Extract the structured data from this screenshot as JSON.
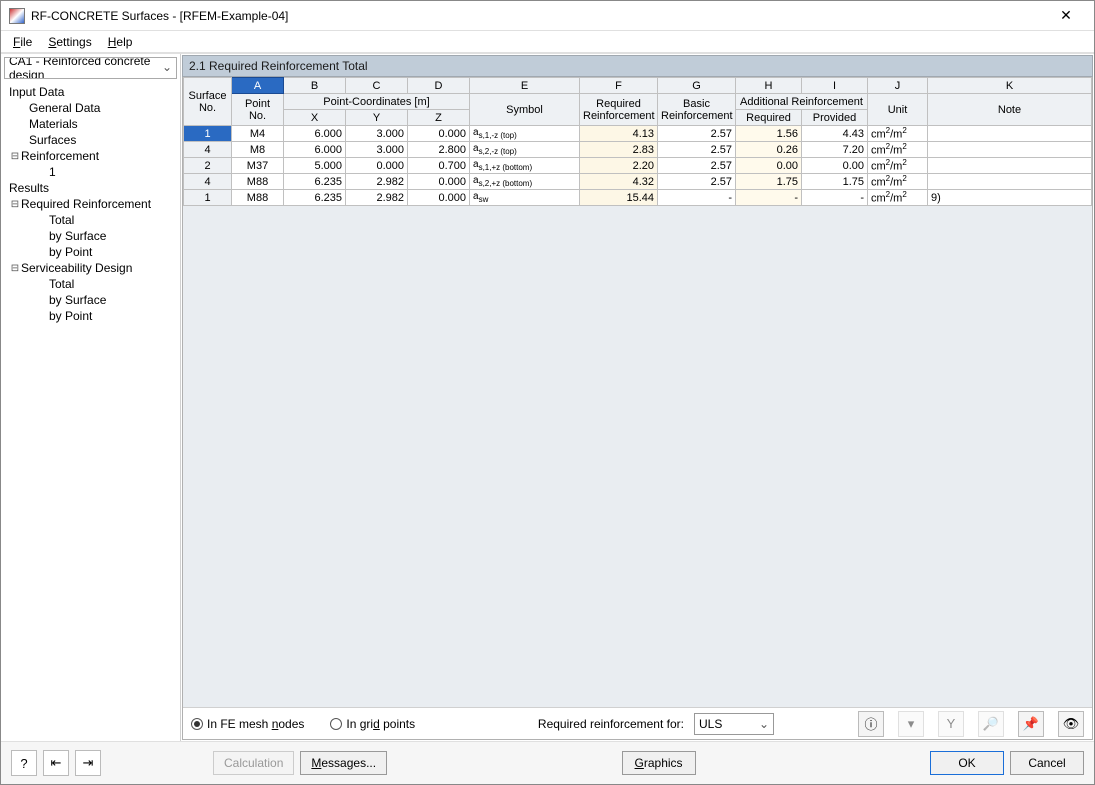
{
  "window": {
    "title": "RF-CONCRETE Surfaces - [RFEM-Example-04]"
  },
  "menu": {
    "file": "File",
    "settings": "Settings",
    "help": "Help"
  },
  "sidebar": {
    "combo": "CA1 - Reinforced concrete design",
    "tree": {
      "input_data": "Input Data",
      "general_data": "General Data",
      "materials": "Materials",
      "surfaces": "Surfaces",
      "reinforcement": "Reinforcement",
      "one": "1",
      "results": "Results",
      "required_reinforcement": "Required Reinforcement",
      "total": "Total",
      "by_surface": "by Surface",
      "by_point": "by Point",
      "serviceability": "Serviceability Design",
      "total2": "Total",
      "by_surface2": "by Surface",
      "by_point2": "by Point"
    }
  },
  "panel": {
    "title": "2.1 Required Reinforcement Total"
  },
  "columns": {
    "letters": [
      "A",
      "B",
      "C",
      "D",
      "E",
      "F",
      "G",
      "H",
      "I",
      "J",
      "K"
    ],
    "h_surface": "Surface\nNo.",
    "h_point": "Point\nNo.",
    "h_coords": "Point-Coordinates [m]",
    "h_x": "X",
    "h_y": "Y",
    "h_z": "Z",
    "h_symbol": "Symbol",
    "h_req": "Required\nReinforcement",
    "h_basic": "Basic\nReinforcement",
    "h_add": "Additional Reinforcement",
    "h_add_req": "Required",
    "h_add_prov": "Provided",
    "h_unit": "Unit",
    "h_note": "Note"
  },
  "rows": [
    {
      "surf": "1",
      "pt": "M4",
      "x": "6.000",
      "y": "3.000",
      "z": "0.000",
      "sym": "a s,1,-z (top)",
      "req": "4.13",
      "basic": "2.57",
      "areq": "1.56",
      "aprov": "4.43",
      "unit": "cm²/m",
      "note": ""
    },
    {
      "surf": "4",
      "pt": "M8",
      "x": "6.000",
      "y": "3.000",
      "z": "2.800",
      "sym": "a s,2,-z (top)",
      "req": "2.83",
      "basic": "2.57",
      "areq": "0.26",
      "aprov": "7.20",
      "unit": "cm²/m",
      "note": ""
    },
    {
      "surf": "2",
      "pt": "M37",
      "x": "5.000",
      "y": "0.000",
      "z": "0.700",
      "sym": "a s,1,+z (bottom)",
      "req": "2.20",
      "basic": "2.57",
      "areq": "0.00",
      "aprov": "0.00",
      "unit": "cm²/m",
      "note": ""
    },
    {
      "surf": "4",
      "pt": "M88",
      "x": "6.235",
      "y": "2.982",
      "z": "0.000",
      "sym": "a s,2,+z (bottom)",
      "req": "4.32",
      "basic": "2.57",
      "areq": "1.75",
      "aprov": "1.75",
      "unit": "cm²/m",
      "note": ""
    },
    {
      "surf": "1",
      "pt": "M88",
      "x": "6.235",
      "y": "2.982",
      "z": "0.000",
      "sym": "a sw",
      "req": "15.44",
      "basic": "-",
      "areq": "-",
      "aprov": "-",
      "unit": "cm²/m²",
      "note": "9)"
    }
  ],
  "bottom": {
    "radio1": "In FE mesh nodes",
    "radio2": "In grid points",
    "label_reqfor": "Required reinforcement for:",
    "select_val": "ULS"
  },
  "footer": {
    "calc": "Calculation",
    "msg": "Messages...",
    "graphics": "Graphics",
    "ok": "OK",
    "cancel": "Cancel"
  }
}
